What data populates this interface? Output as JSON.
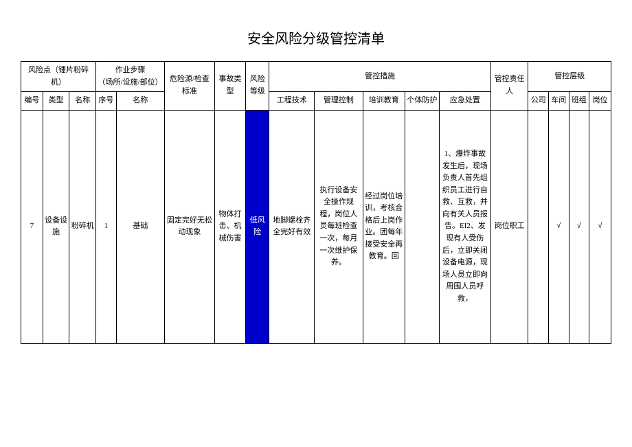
{
  "title": "安全风险分级管控清单",
  "headers": {
    "risk_point": "风险点（锤片粉碎机）",
    "work_step": "作业步骤\n（场所/设施/部位）",
    "hazard_std": "危险源/检查标准",
    "accident_type": "事故类型",
    "risk_level": "风险等级",
    "control_measure": "管控措施",
    "responsible": "管控责任人",
    "control_level": "管控层级",
    "sub": {
      "num": "编号",
      "type": "类型",
      "name": "名称",
      "seq": "序号",
      "step_name": "名称",
      "eng": "工程技术",
      "mgmt": "管理控制",
      "train": "培训教育",
      "ppe": "个体防护",
      "emerg": "应急处置",
      "company": "公司",
      "workshop": "车间",
      "team": "班组",
      "post": "岗位"
    }
  },
  "row": {
    "num": "7",
    "type": "设备设施",
    "name": "粉碎机",
    "seq": "1",
    "step_name": "基础",
    "hazard": "固定完好无松动现象",
    "accident": "物体打击、机械伤害",
    "risk": "低风险",
    "eng": "地脚螺栓齐全完好有效",
    "mgmt": "执行设备安全操作规程，岗位人员每班检查一次，每月一次维护保养。",
    "train": "经过岗位培训，考核合格后上岗作业。团每年接受安全再教育。回",
    "ppe": "",
    "emerg": "1、爆炸事故发生后，现场负责人首先组织员工进行自救、互救，并向有关人员报告。EI2、发现有人受伤后，立即关闭设备电源，现场人员立即向周围人员呼救，",
    "responsible": "岗位职工",
    "company": "",
    "workshop": "√",
    "team": "√",
    "post": "√"
  }
}
